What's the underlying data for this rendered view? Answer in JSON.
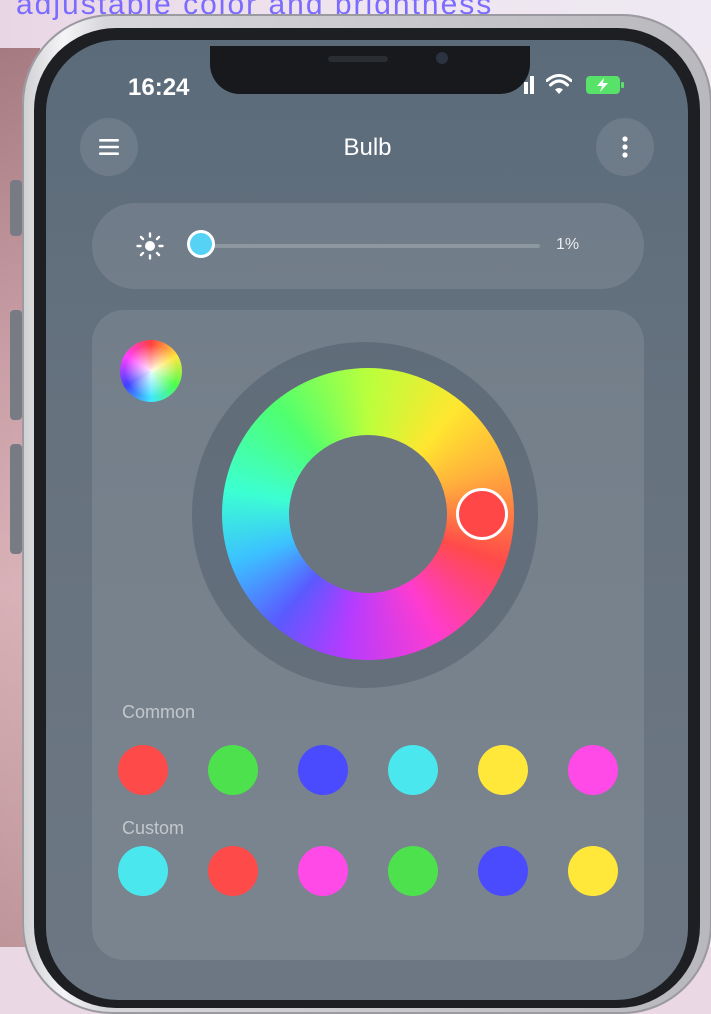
{
  "caption_text": "adjustable color and brightness",
  "status_bar": {
    "time": "16:24"
  },
  "header": {
    "title": "Bulb"
  },
  "brightness": {
    "level": 0.01,
    "percent_label": "1%"
  },
  "color_wheel": {
    "selected_color": "#ff4747"
  },
  "sections": {
    "common": {
      "label": "Common",
      "colors": [
        "#ff4a4a",
        "#4de24d",
        "#4a4aff",
        "#4ae8ee",
        "#ffe83a",
        "#ff4ae8"
      ]
    },
    "custom": {
      "label": "Custom",
      "colors": [
        "#4ae8ee",
        "#ff4a4a",
        "#ff4ae8",
        "#4de24d",
        "#4a4aff",
        "#ffe83a"
      ]
    }
  },
  "icons": {
    "menu": "menu-icon",
    "more": "more-vertical-icon",
    "brightness": "sun-icon",
    "wifi": "wifi-icon",
    "battery": "battery-charging-icon",
    "signal": "signal-icon"
  }
}
